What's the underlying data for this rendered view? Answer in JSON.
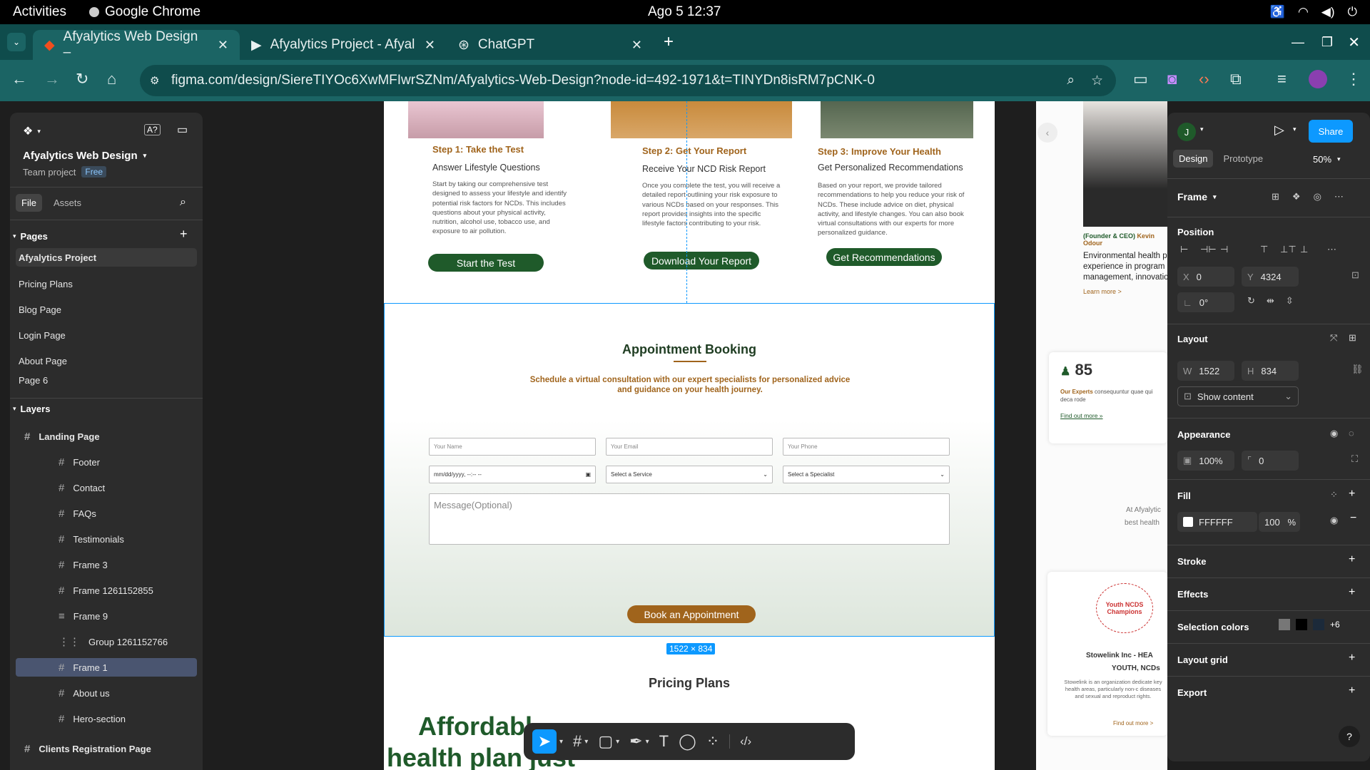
{
  "os_bar": {
    "activities": "Activities",
    "app": "Google Chrome",
    "clock": "Ago 5  12:37"
  },
  "tabs": [
    {
      "label": "Afyalytics Web Design –"
    },
    {
      "label": "Afyalytics Project - Afyal"
    },
    {
      "label": "ChatGPT"
    }
  ],
  "address": {
    "url": "figma.com/design/SiereTIYOc6XwMFIwrSZNm/Afyalytics-Web-Design?node-id=492-1971&t=TINYDn8isRM7pCNK-0"
  },
  "left_panel": {
    "file_name": "Afyalytics Web Design",
    "team": "Team project",
    "plan_badge": "Free",
    "tab_file": "File",
    "tab_assets": "Assets",
    "pages_label": "Pages",
    "pages": [
      "Afyalytics Project",
      "Pricing Plans",
      "Blog Page",
      "Login Page",
      "About Page",
      "Page 6"
    ],
    "layers_label": "Layers",
    "root_layer": "Landing Page",
    "layers": [
      "Footer",
      "Contact",
      "FAQs",
      "Testimonials",
      "Frame 3",
      "Frame 1261152855",
      "Frame 9",
      "Group 1261152766",
      "Frame 1",
      "About us",
      "Hero-section"
    ],
    "bottom_layer": "Clients Registration Page"
  },
  "design": {
    "steps": [
      {
        "title": "Step 1: Take the Test",
        "subtitle": "Answer Lifestyle Questions",
        "body": "Start by taking our comprehensive test designed to assess your lifestyle and identify potential risk factors for NCDs. This includes questions about your physical activity, nutrition, alcohol use, tobacco use, and exposure to air pollution.",
        "button": "Start the Test"
      },
      {
        "title": "Step 2: Get Your Report",
        "subtitle": "Receive Your NCD Risk Report",
        "body": "Once you complete the test, you will receive a detailed report outlining your risk exposure to various NCDs based on your responses. This report provides insights into the specific lifestyle factors contributing to your risk.",
        "button": "Download Your Report"
      },
      {
        "title": "Step 3: Improve Your Health",
        "subtitle": "Get Personalized Recommendations",
        "body": "Based on your report, we provide tailored recommendations to help you reduce your risk of NCDs. These include advice on diet, physical activity, and lifestyle changes. You can also book virtual consultations with our experts for more personalized guidance.",
        "button": "Get Recommendations"
      }
    ],
    "booking": {
      "title": "Appointment Booking",
      "subtitle": "Schedule a virtual consultation with our expert specialists for personalized advice and guidance on your health journey.",
      "name_ph": "Your Name",
      "email_ph": "Your Email",
      "phone_ph": "Your Phone",
      "date_ph": "mm/dd/yyyy, --:-- --",
      "service": "Select a Service",
      "specialist": "Select a Specialist",
      "message_ph": "Message(Optional)",
      "button": "Book an Appointment"
    },
    "size_badge": "1522 × 834",
    "pricing_title": "Pricing Plans",
    "pricing_heading_1": "Affordabl",
    "pricing_heading_2": "health plan just"
  },
  "side_design": {
    "founder": "(Founder & CEO)",
    "founder_name": "Kevin Odour",
    "blurb_1": "Environmental health p",
    "blurb_2": "experience in program",
    "blurb_3": "management, innovatio",
    "learn_more": "Learn more >",
    "stat": "85",
    "stat_label": "Our Experts",
    "stat_text": "consequuntur quae qui deca rode",
    "find_out": "Find out more »",
    "about_1": "At Afyalytic",
    "about_2": "best health",
    "partner_logo": "Youth NCDS Champions",
    "partner_name_1": "Stowelink Inc - HEA",
    "partner_name_2": "YOUTH, NCDs",
    "partner_desc": "Stowelink is an organization dedicate key health areas, particularly non-c diseases and sexual and reproduct rights.",
    "partner_more": "Find out more >"
  },
  "right_panel": {
    "avatar": "J",
    "share": "Share",
    "tab_design": "Design",
    "tab_prototype": "Prototype",
    "zoom": "50%",
    "frame_label": "Frame",
    "position": "Position",
    "x_label": "X",
    "x": "0",
    "y_label": "Y",
    "y": "4324",
    "rotation": "0°",
    "layout": "Layout",
    "w_label": "W",
    "w": "1522",
    "h_label": "H",
    "h": "834",
    "show_content": "Show content",
    "appearance": "Appearance",
    "opacity": "100%",
    "radius": "0",
    "fill": "Fill",
    "fill_hex": "FFFFFF",
    "fill_opacity": "100",
    "fill_pct": "%",
    "stroke": "Stroke",
    "effects": "Effects",
    "selection_colors": "Selection colors",
    "extra_colors": "+6",
    "layout_grid": "Layout grid",
    "export": "Export",
    "help": "?"
  },
  "colors": {
    "accent": "#0d99ff",
    "brand_green": "#1f5a2a",
    "brand_gold": "#a0641c",
    "tab_bg": "#0f4c4c"
  }
}
